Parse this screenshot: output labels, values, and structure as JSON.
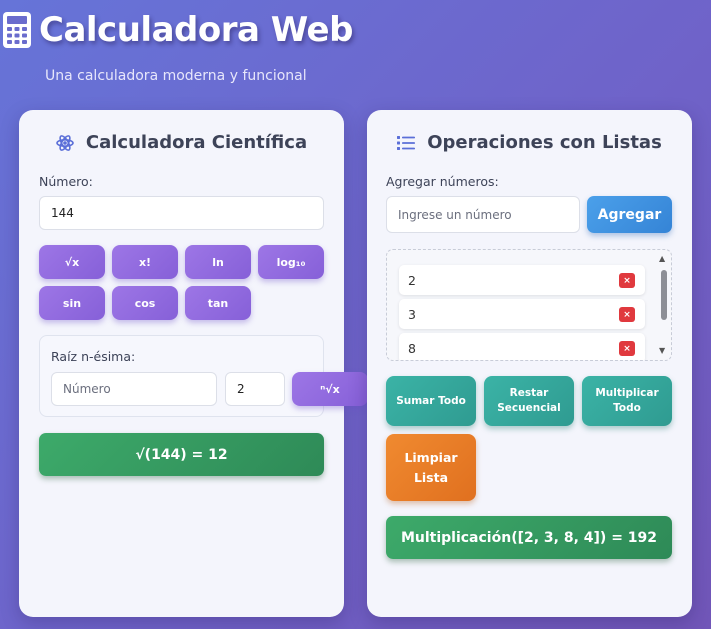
{
  "header": {
    "title": "Calculadora Web",
    "subtitle": "Una calculadora moderna y funcional",
    "icon": "calculator-icon"
  },
  "scientific": {
    "title": "Calculadora Científica",
    "icon": "atom-icon",
    "number_label": "Número:",
    "number_value": "144",
    "buttons": [
      "√x",
      "x!",
      "ln",
      "log₁₀",
      "sin",
      "cos",
      "tan"
    ],
    "nth_root": {
      "label": "Raíz n-ésima:",
      "number_placeholder": "Número",
      "index_value": "2",
      "button": "ⁿ√x"
    },
    "result": "√(144) = 12"
  },
  "lists": {
    "title": "Operaciones con Listas",
    "icon": "list-icon",
    "add_label": "Agregar números:",
    "add_placeholder": "Ingrese un número",
    "add_button": "Agregar",
    "items": [
      "2",
      "3",
      "8"
    ],
    "delete_symbol": "×",
    "ops": {
      "sum": "Sumar Todo",
      "subtract": "Restar Secuencial",
      "multiply": "Multiplicar Todo",
      "clear": "Limpiar Lista"
    },
    "result": "Multiplicación([2, 3, 8, 4]) = 192"
  },
  "colors": {
    "background": "#6f6acb",
    "purple_button": "#8f68de",
    "green_result": "#349a5f",
    "blue_button": "#3b8de0",
    "teal_button": "#35a89c",
    "orange_button": "#e8792a",
    "delete_red": "#e0393e"
  }
}
